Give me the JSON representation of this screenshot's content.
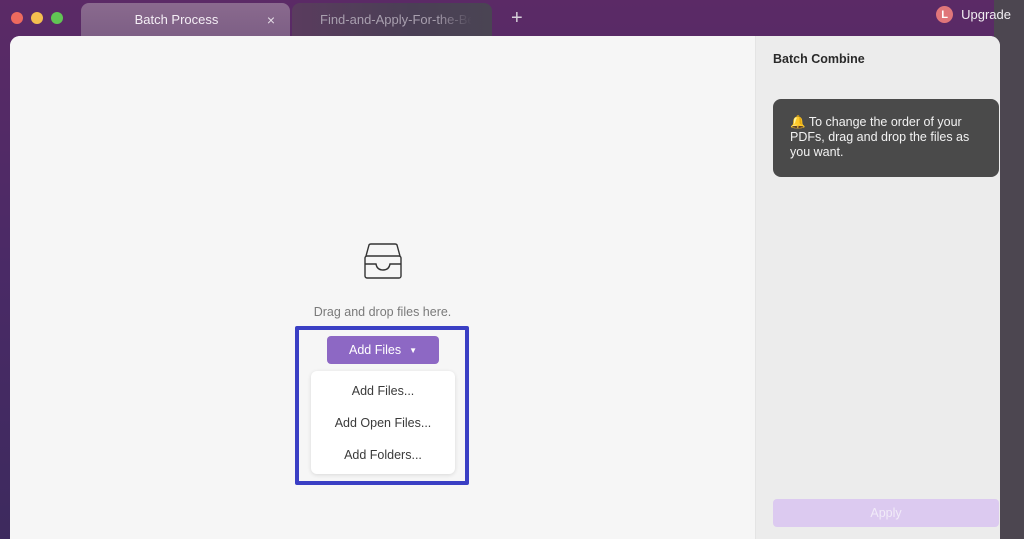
{
  "window_controls": {
    "close": "close-window",
    "minimize": "minimize-window",
    "zoom": "zoom-window"
  },
  "tabs": [
    {
      "label": "Batch Process",
      "active": true,
      "close_icon": "×"
    },
    {
      "label": "Find-and-Apply-For-the-Best-Institutional-Grants",
      "active": false
    }
  ],
  "tab_add_icon": "+",
  "account": {
    "avatar_initial": "L",
    "upgrade_label": "Upgrade"
  },
  "main": {
    "drop_text": "Drag and drop files here.",
    "add_files_button": {
      "label": "Add Files",
      "caret": "▼"
    },
    "menu": [
      {
        "label": "Add Files..."
      },
      {
        "label": "Add Open Files..."
      },
      {
        "label": "Add Folders..."
      }
    ]
  },
  "side": {
    "title": "Batch Combine",
    "tip": {
      "icon": "🔔",
      "text": "To change the order of your PDFs, drag and drop the files as you want."
    },
    "apply_label": "Apply"
  },
  "colors": {
    "accent": "#8d68c4",
    "highlight_border": "#3a3fc4",
    "apply_disabled": "#dccaf0",
    "tip_bg": "#4a4a4a"
  }
}
